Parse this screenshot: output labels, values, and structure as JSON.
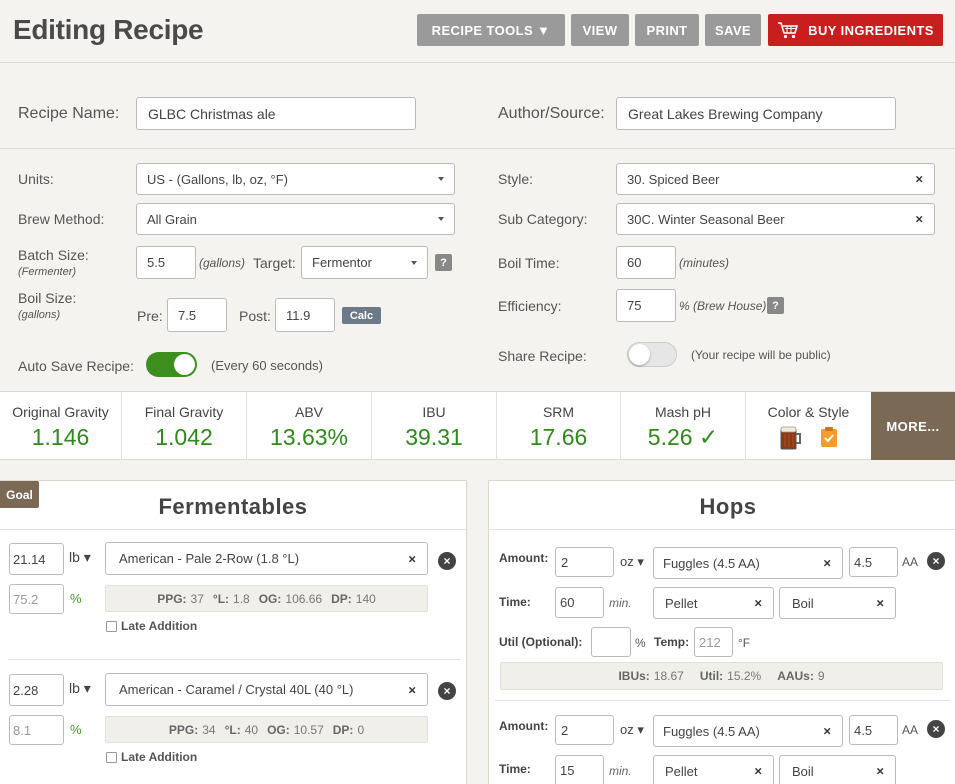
{
  "header": {
    "title": "Editing Recipe",
    "buttons": {
      "recipe_tools": "RECIPE TOOLS ▼",
      "view": "VIEW",
      "print": "PRINT",
      "save": "SAVE",
      "buy": "BUY INGREDIENTS"
    }
  },
  "form": {
    "recipe_name_label": "Recipe Name:",
    "recipe_name": "GLBC Christmas ale",
    "author_label": "Author/Source:",
    "author": "Great Lakes Brewing Company",
    "units_label": "Units:",
    "units": "US - (Gallons, lb, oz, °F)",
    "brew_method_label": "Brew Method:",
    "brew_method": "All Grain",
    "batch_size_label": "Batch Size:",
    "batch_size_sub": "(Fermenter)",
    "batch_size": "5.5",
    "batch_unit": "(gallons)",
    "target_label": "Target:",
    "target": "Fermentor",
    "help": "?",
    "boil_size_label": "Boil Size:",
    "boil_size_sub": "(gallons)",
    "pre_label": "Pre:",
    "pre": "7.5",
    "post_label": "Post:",
    "post": "11.9",
    "calc": "Calc",
    "autosave_label": "Auto Save Recipe:",
    "autosave_on": true,
    "autosave_hint": "(Every 60 seconds)",
    "style_label": "Style:",
    "style": "30. Spiced Beer",
    "subcat_label": "Sub Category:",
    "subcat": "30C. Winter Seasonal Beer",
    "boil_time_label": "Boil Time:",
    "boil_time": "60",
    "boil_time_unit": "(minutes)",
    "efficiency_label": "Efficiency:",
    "efficiency": "75",
    "efficiency_unit": "% (Brew House)",
    "share_label": "Share Recipe:",
    "share_on": false,
    "share_hint": "(Your recipe will be public)"
  },
  "stats": [
    {
      "label": "Original Gravity",
      "value": "1.146"
    },
    {
      "label": "Final Gravity",
      "value": "1.042"
    },
    {
      "label": "ABV",
      "value": "13.63%"
    },
    {
      "label": "IBU",
      "value": "39.31"
    },
    {
      "label": "SRM",
      "value": "17.66"
    },
    {
      "label": "Mash pH",
      "value": "5.26 ✓"
    },
    {
      "label": "Color & Style",
      "value": ""
    }
  ],
  "more": "MORE...",
  "colors": {
    "green": "#2e8b1a",
    "brown": "#7a6a55",
    "red": "#c81e1e",
    "beer": "#8b3a14"
  },
  "goal": "Goal",
  "fermentables": {
    "title": "Fermentables",
    "items": [
      {
        "amount": "21.14",
        "unit": "lb ▾",
        "name": "American - Pale 2-Row (1.8 °L)",
        "percent": "75.2",
        "ppg": "37",
        "l": "1.8",
        "og": "106.66",
        "dp": "140"
      },
      {
        "amount": "2.28",
        "unit": "lb ▾",
        "name": "American - Caramel / Crystal 40L (40 °L)",
        "percent": "8.1",
        "ppg": "34",
        "l": "40",
        "og": "10.57",
        "dp": "0"
      }
    ],
    "pct_sign": "%",
    "late_label": "Late Addition",
    "k_ppg": "PPG:",
    "k_l": "°L:",
    "k_og": "OG:",
    "k_dp": "DP:"
  },
  "hops": {
    "title": "Hops",
    "amount_label": "Amount:",
    "time_label": "Time:",
    "util_label": "Util (Optional):",
    "temp_label": "Temp:",
    "min": "min.",
    "pct": "%",
    "deg": "°F",
    "k_ibus": "IBUs:",
    "k_util": "Util:",
    "k_aaus": "AAUs:",
    "aa": "AA",
    "items": [
      {
        "amount": "2",
        "unit": "oz ▾",
        "name": "Fuggles (4.5 AA)",
        "aa_value": "4.5",
        "time": "60",
        "form": "Pellet",
        "use": "Boil",
        "util": "",
        "temp_placeholder": "212",
        "ibus": "18.67",
        "util_pct": "15.2%",
        "aaus": "9"
      },
      {
        "amount": "2",
        "unit": "oz ▾",
        "name": "Fuggles (4.5 AA)",
        "aa_value": "4.5",
        "time": "15",
        "form": "Pellet",
        "use": "Boil"
      }
    ]
  }
}
